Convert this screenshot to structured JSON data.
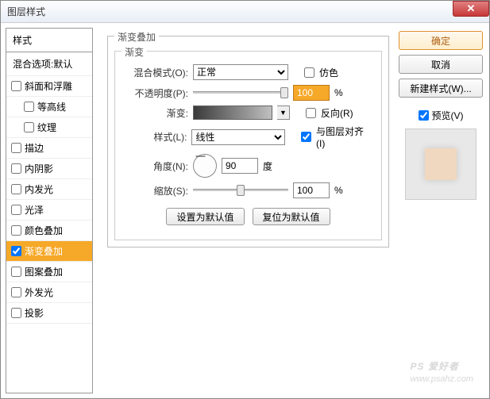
{
  "window": {
    "title": "图层样式"
  },
  "left": {
    "header": "样式",
    "blend_options": "混合选项:默认",
    "items": [
      {
        "label": "斜面和浮雕",
        "checked": false,
        "indent": false
      },
      {
        "label": "等高线",
        "checked": false,
        "indent": true
      },
      {
        "label": "纹理",
        "checked": false,
        "indent": true
      },
      {
        "label": "描边",
        "checked": false,
        "indent": false
      },
      {
        "label": "内阴影",
        "checked": false,
        "indent": false
      },
      {
        "label": "内发光",
        "checked": false,
        "indent": false
      },
      {
        "label": "光泽",
        "checked": false,
        "indent": false
      },
      {
        "label": "颜色叠加",
        "checked": false,
        "indent": false
      },
      {
        "label": "渐变叠加",
        "checked": true,
        "indent": false,
        "selected": true
      },
      {
        "label": "图案叠加",
        "checked": false,
        "indent": false
      },
      {
        "label": "外发光",
        "checked": false,
        "indent": false
      },
      {
        "label": "投影",
        "checked": false,
        "indent": false
      }
    ]
  },
  "center": {
    "group_title": "渐变叠加",
    "inner_title": "渐变",
    "blend_mode": {
      "label": "混合模式(O):",
      "value": "正常"
    },
    "dither": {
      "label": "仿色",
      "checked": false
    },
    "opacity": {
      "label": "不透明度(P):",
      "value": "100",
      "unit": "%"
    },
    "gradient": {
      "label": "渐变:"
    },
    "reverse": {
      "label": "反向(R)",
      "checked": false
    },
    "style": {
      "label": "样式(L):",
      "value": "线性"
    },
    "align": {
      "label": "与图层对齐(I)",
      "checked": true
    },
    "angle": {
      "label": "角度(N):",
      "value": "90",
      "unit": "度"
    },
    "scale": {
      "label": "缩放(S):",
      "value": "100",
      "unit": "%"
    },
    "btn_default": "设置为默认值",
    "btn_reset": "复位为默认值"
  },
  "right": {
    "ok": "确定",
    "cancel": "取消",
    "newstyle": "新建样式(W)...",
    "preview": {
      "label": "预览(V)",
      "checked": true
    }
  },
  "watermark": {
    "main": "PS 爱好者",
    "url": "www.psahz.com"
  }
}
